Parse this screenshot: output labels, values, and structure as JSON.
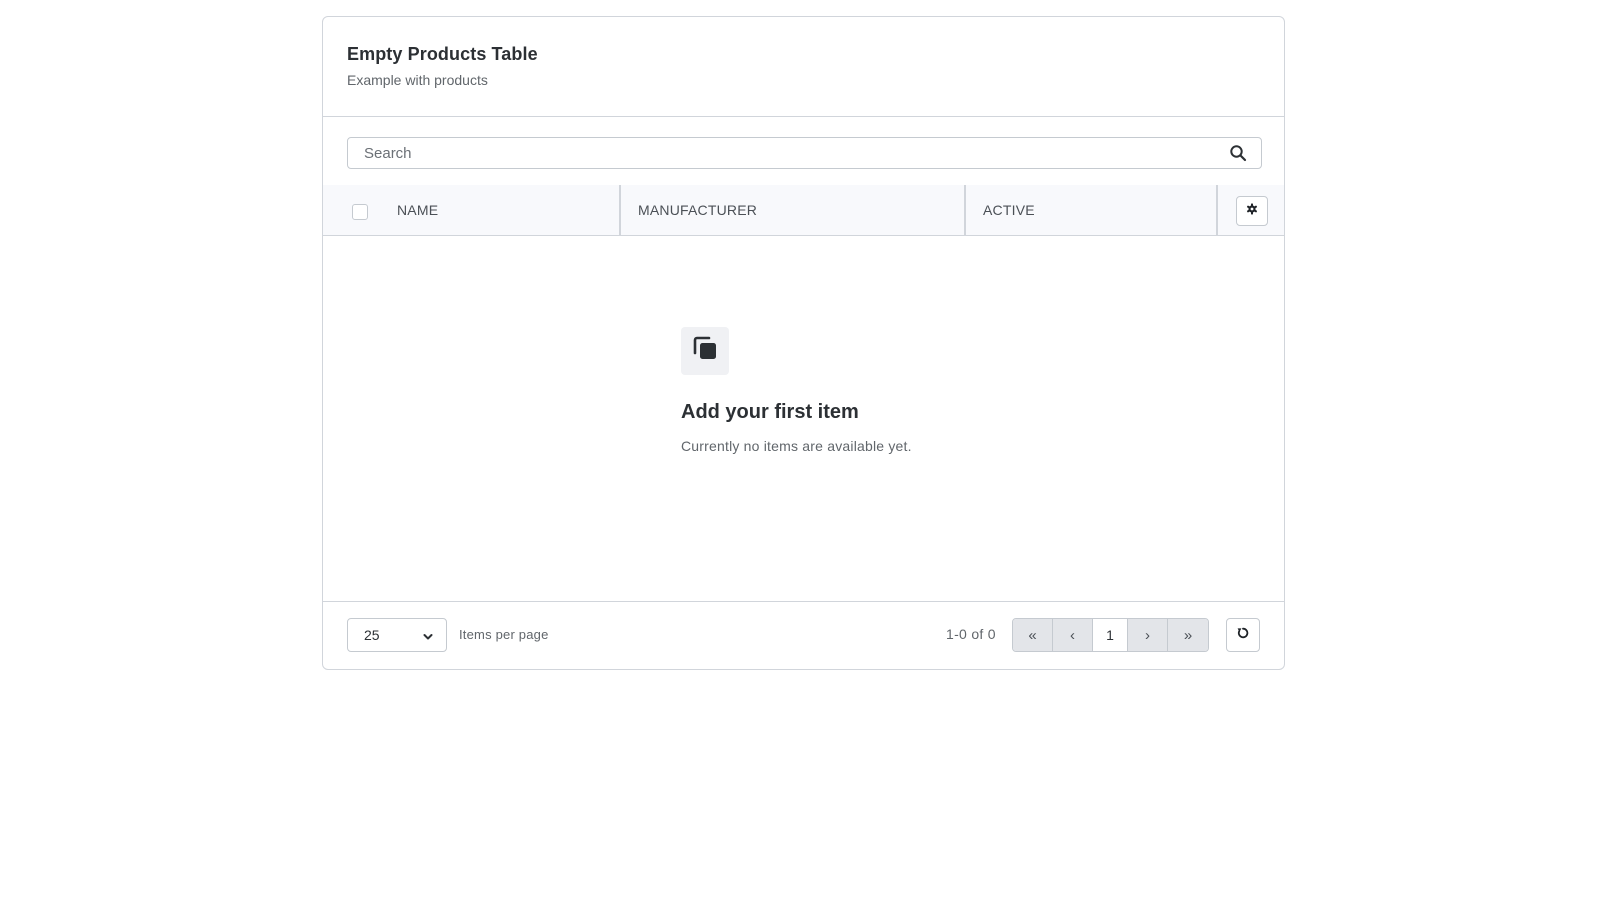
{
  "card": {
    "title": "Empty Products Table",
    "subtitle": "Example with products"
  },
  "search": {
    "placeholder": "Search",
    "value": "",
    "icon": "search-icon"
  },
  "table": {
    "columns": [
      "NAME",
      "MANUFACTURER",
      "ACTIVE"
    ],
    "settings_icon": "gear-icon",
    "select_all_checked": false
  },
  "empty_state": {
    "icon": "copy-icon",
    "title": "Add your first item",
    "text": "Currently no items are available yet."
  },
  "footer": {
    "per_page_value": "25",
    "per_page_label": "Items per page",
    "range_text": "1-0 of 0",
    "pagination": {
      "first": "«",
      "prev": "‹",
      "current_page": "1",
      "next": "›",
      "last": "»"
    },
    "refresh_icon": "refresh-icon"
  },
  "colors": {
    "border": "#d1d5db",
    "header_bg": "#f8f9fc",
    "pager_disabled_bg": "#e3e5e9",
    "text_primary": "#2c3034",
    "text_secondary": "#61666b"
  }
}
